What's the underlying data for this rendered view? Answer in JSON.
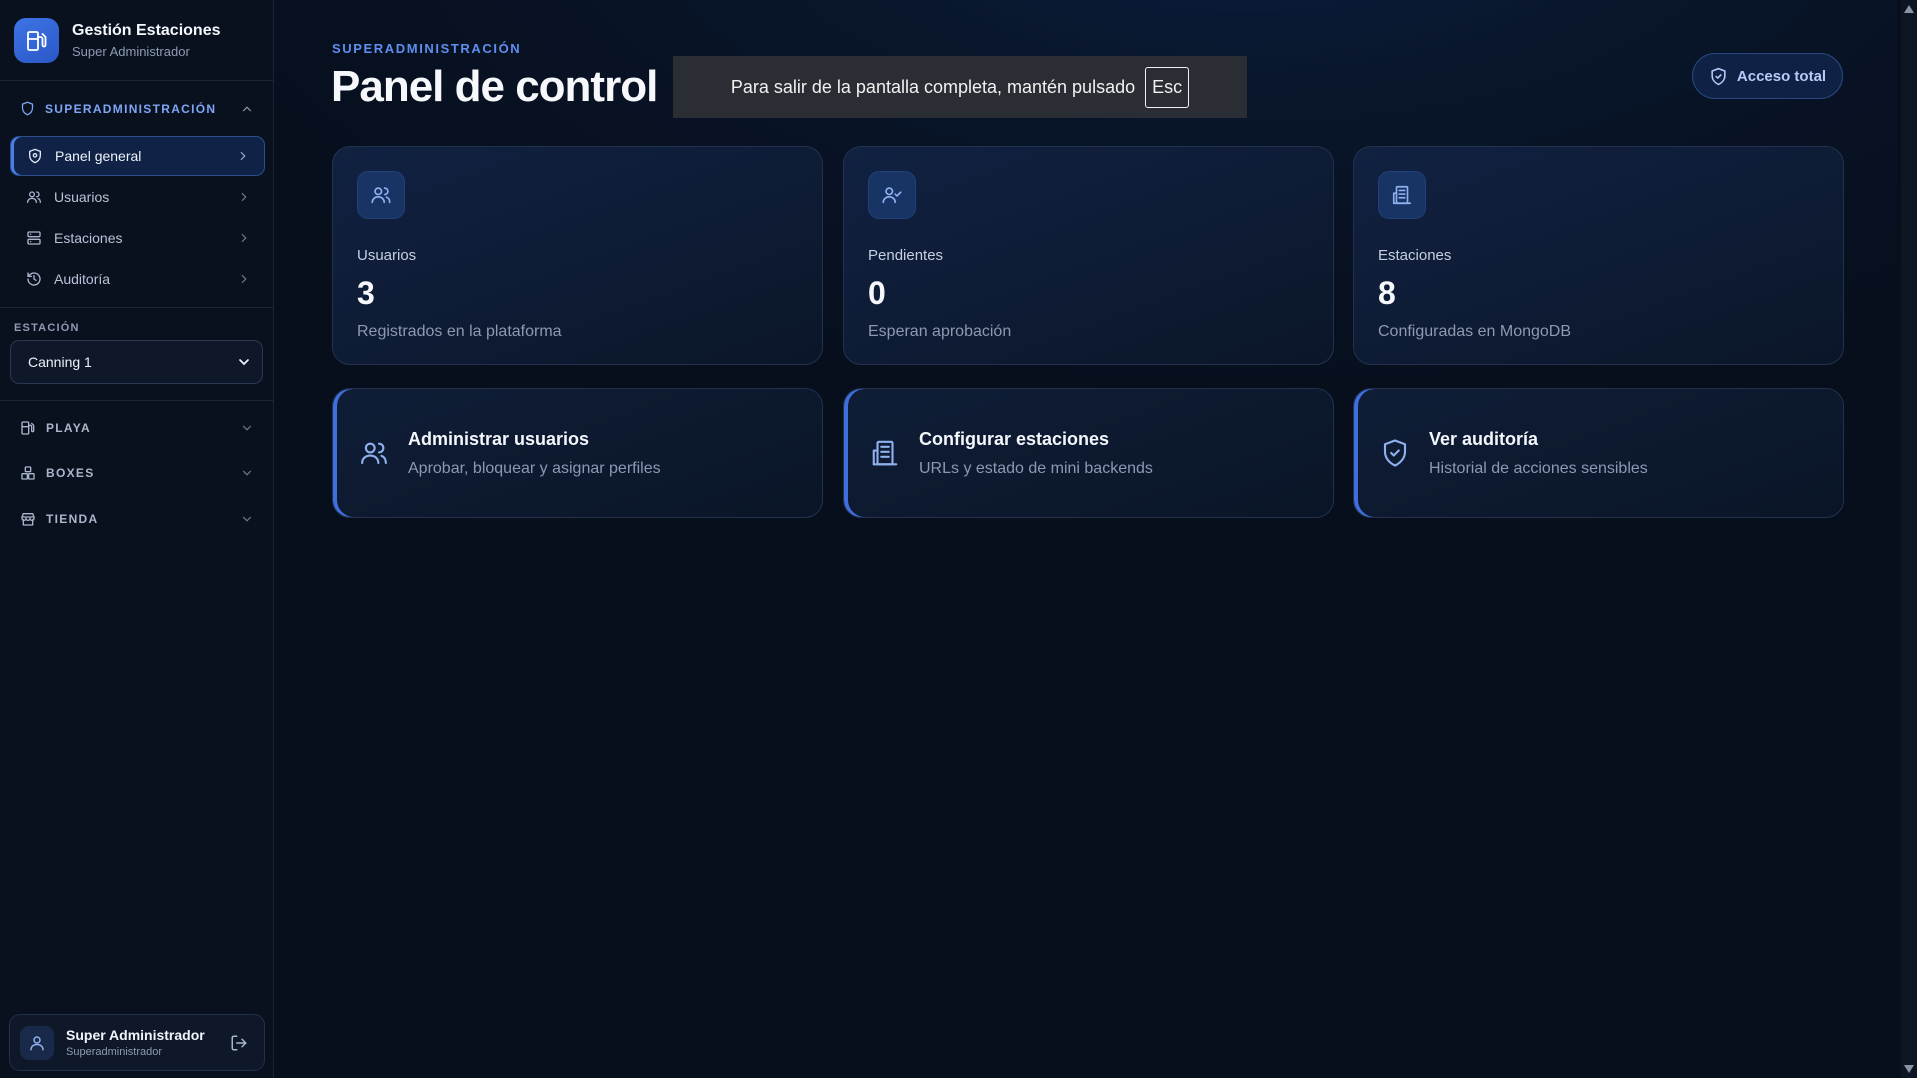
{
  "brand": {
    "title": "Gestión Estaciones",
    "subtitle": "Super Administrador"
  },
  "sidebar": {
    "superadmin_section": "SUPERADMINISTRACIÓN",
    "items": [
      {
        "label": "Panel general",
        "icon": "shield-icon",
        "active": true
      },
      {
        "label": "Usuarios",
        "icon": "users-icon"
      },
      {
        "label": "Estaciones",
        "icon": "server-icon"
      },
      {
        "label": "Auditoría",
        "icon": "history-icon"
      }
    ],
    "station_label": "ESTACIÓN",
    "station_selected": "Canning 1",
    "groups": [
      {
        "label": "PLAYA",
        "icon": "fuel-pump-icon"
      },
      {
        "label": "BOXES",
        "icon": "boxes-icon"
      },
      {
        "label": "TIENDA",
        "icon": "store-icon"
      }
    ]
  },
  "user": {
    "name": "Super Administrador",
    "role": "Superadministrador"
  },
  "header": {
    "kicker": "SUPERADMINISTRACIÓN",
    "title": "Panel de control",
    "access_label": "Acceso total"
  },
  "fullscreen_notice": {
    "text": "Para salir de la pantalla completa, mantén pulsado",
    "key": "Esc"
  },
  "stats": [
    {
      "label": "Usuarios",
      "value": "3",
      "desc": "Registrados en la plataforma",
      "icon": "users-icon"
    },
    {
      "label": "Pendientes",
      "value": "0",
      "desc": "Esperan aprobación",
      "icon": "user-check-icon"
    },
    {
      "label": "Estaciones",
      "value": "8",
      "desc": "Configuradas en MongoDB",
      "icon": "building-icon"
    }
  ],
  "actions": [
    {
      "title": "Administrar usuarios",
      "desc": "Aprobar, bloquear y asignar perfiles",
      "icon": "users-icon"
    },
    {
      "title": "Configurar estaciones",
      "desc": "URLs y estado de mini backends",
      "icon": "building-icon"
    },
    {
      "title": "Ver auditoría",
      "desc": "Historial de acciones sensibles",
      "icon": "shield-check-icon"
    }
  ],
  "colors": {
    "accent": "#4a7fe8",
    "kicker": "#5f8ef0",
    "background": "#070f1d"
  }
}
